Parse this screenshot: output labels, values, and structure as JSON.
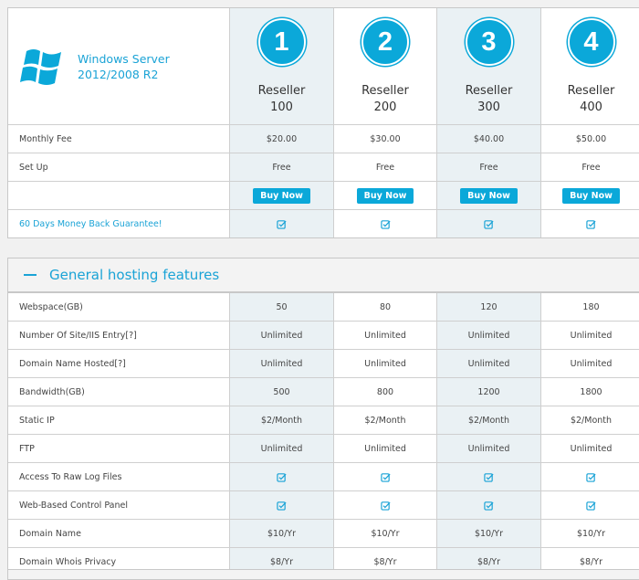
{
  "product": {
    "line1": "Windows Server",
    "line2": "2012/2008 R2",
    "icon": "windows-logo-icon",
    "brand_color": "#0ba8d9"
  },
  "plans": [
    {
      "number": "1",
      "name": "Reseller",
      "tier": "100",
      "monthly_fee": "$20.00",
      "setup": "Free",
      "buy_label": "Buy Now"
    },
    {
      "number": "2",
      "name": "Reseller",
      "tier": "200",
      "monthly_fee": "$30.00",
      "setup": "Free",
      "buy_label": "Buy Now"
    },
    {
      "number": "3",
      "name": "Reseller",
      "tier": "300",
      "monthly_fee": "$40.00",
      "setup": "Free",
      "buy_label": "Buy Now"
    },
    {
      "number": "4",
      "name": "Reseller",
      "tier": "400",
      "monthly_fee": "$50.00",
      "setup": "Free",
      "buy_label": "Buy Now"
    }
  ],
  "pricing_rows": {
    "monthly_fee_label": "Monthly Fee",
    "setup_label": "Set Up",
    "guarantee_label": "60 Days Money Back Guarantee!",
    "guarantee_values": [
      "check",
      "check",
      "check",
      "check"
    ]
  },
  "features_section": {
    "title": "General hosting features",
    "rows": [
      {
        "label": "Webspace(GB)",
        "values": [
          "50",
          "80",
          "120",
          "180"
        ]
      },
      {
        "label": "Number Of Site/IIS Entry[?]",
        "values": [
          "Unlimited",
          "Unlimited",
          "Unlimited",
          "Unlimited"
        ]
      },
      {
        "label": "Domain Name Hosted[?]",
        "values": [
          "Unlimited",
          "Unlimited",
          "Unlimited",
          "Unlimited"
        ]
      },
      {
        "label": "Bandwidth(GB)",
        "values": [
          "500",
          "800",
          "1200",
          "1800"
        ]
      },
      {
        "label": "Static IP",
        "values": [
          "$2/Month",
          "$2/Month",
          "$2/Month",
          "$2/Month"
        ]
      },
      {
        "label": "FTP",
        "values": [
          "Unlimited",
          "Unlimited",
          "Unlimited",
          "Unlimited"
        ]
      },
      {
        "label": "Access To Raw Log Files",
        "values": [
          "check",
          "check",
          "check",
          "check"
        ]
      },
      {
        "label": "Web-Based Control Panel",
        "values": [
          "check",
          "check",
          "check",
          "check"
        ]
      },
      {
        "label": "Domain Name",
        "values": [
          "$10/Yr",
          "$10/Yr",
          "$10/Yr",
          "$10/Yr"
        ]
      },
      {
        "label": "Domain Whois Privacy",
        "values": [
          "$8/Yr",
          "$8/Yr",
          "$8/Yr",
          "$8/Yr"
        ]
      }
    ]
  }
}
